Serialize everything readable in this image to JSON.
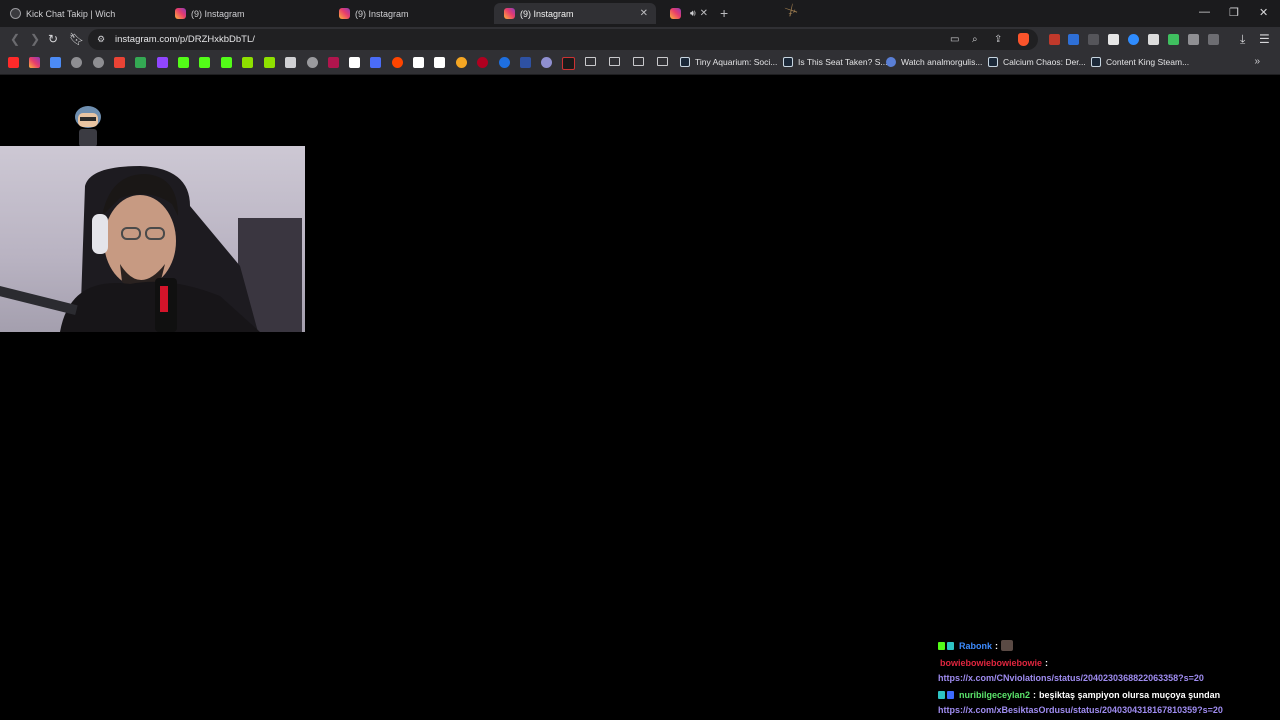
{
  "tabs": [
    {
      "title": "Kick Chat Takip | Wich",
      "favicon": "globe-icon",
      "active": false
    },
    {
      "title": "(9) Instagram",
      "favicon": "instagram-icon",
      "active": false
    },
    {
      "title": "(9) Instagram",
      "favicon": "instagram-icon",
      "active": false
    },
    {
      "title": "(9) Instagram",
      "favicon": "instagram-icon",
      "active": true
    },
    {
      "title": "",
      "favicon": "instagram-icon",
      "active": false,
      "audio": true
    }
  ],
  "address": {
    "url": "instagram.com/p/DRZHxkbDbTL/"
  },
  "bookmarks": {
    "labeled": [
      "Tiny Aquarium: Soci...",
      "Is This Seat Taken? S...",
      "Watch analmorgulis...",
      "Calcium Chaos: Der...",
      "Content King Steam..."
    ]
  },
  "chat": {
    "messages": [
      {
        "user": "Rabonk",
        "user_color": "#3d8bfd",
        "text": ""
      },
      {
        "user": "bowiebowiebowiebowie",
        "user_color": "#e0263f",
        "text": ""
      },
      {
        "user": "",
        "user_color": "",
        "text": "https://x.com/CNviolations/status/2040230368822063358?s=20"
      },
      {
        "user": "nuribilgeceylan2",
        "user_color": "#5be36b",
        "text": "beşiktaş şampiyon olursa muçoya şundan"
      },
      {
        "user": "",
        "user_color": "",
        "text": "https://x.com/xBesiktasOrdusu/status/2040304318167810359?s=20"
      }
    ],
    "separator": ":"
  },
  "colors": {
    "browser_bg": "#303034",
    "tabstrip_bg": "#1b1b1d",
    "page_bg": "#000000",
    "link": "#9f8cf0"
  }
}
